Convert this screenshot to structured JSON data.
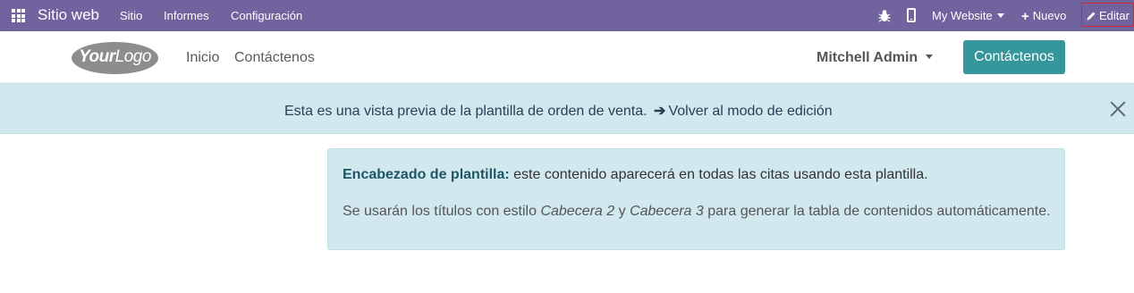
{
  "topbar": {
    "app_name": "Sitio web",
    "menu": [
      "Sitio",
      "Informes",
      "Configuración"
    ],
    "website_selector": "My Website",
    "new_label": "Nuevo",
    "edit_label": "Editar",
    "bg_color": "#71639e"
  },
  "header": {
    "logo_text_bold": "Your",
    "logo_text": "Logo",
    "nav": [
      "Inicio",
      "Contáctenos"
    ],
    "user": "Mitchell Admin",
    "contact_button": "Contáctenos",
    "contact_button_color": "#35979c"
  },
  "banner": {
    "message": "Esta es una vista previa de la plantilla de orden de venta.",
    "link": "Volver al modo de edición"
  },
  "template_box": {
    "title": "Encabezado de plantilla:",
    "text1": "este contenido aparecerá en todas las citas usando esta plantilla.",
    "text2_a": "Se usarán los títulos con estilo ",
    "text2_em1": "Cabecera 2",
    "text2_b": " y ",
    "text2_em2": "Cabecera 3",
    "text2_c": " para generar la tabla de contenidos automáticamente."
  }
}
